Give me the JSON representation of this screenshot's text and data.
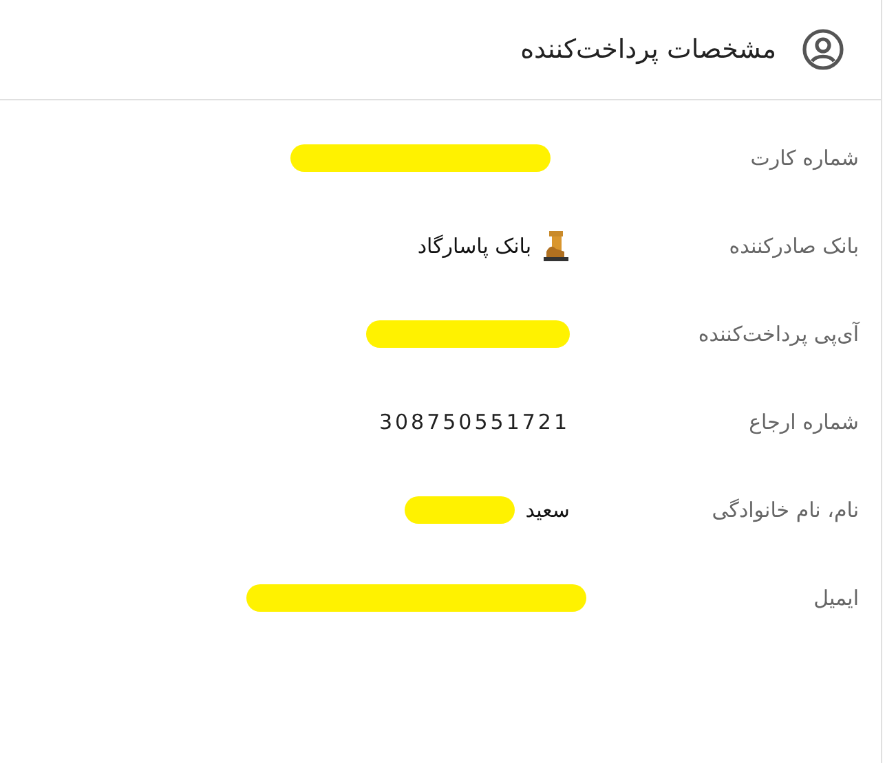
{
  "header": {
    "title": "مشخصات پرداخت‌کننده"
  },
  "rows": [
    {
      "label": "شماره کارت",
      "kind": "redacted"
    },
    {
      "label": "بانک صادرکننده",
      "kind": "bank",
      "value": "بانک پاسارگاد"
    },
    {
      "label": "آی‌پی پرداخت‌کننده",
      "kind": "redacted"
    },
    {
      "label": "شماره ارجاع",
      "kind": "number",
      "value": "308750551721"
    },
    {
      "label": "نام، نام خانوادگی",
      "kind": "name",
      "value": "سعید"
    },
    {
      "label": "ایمیل",
      "kind": "redacted"
    }
  ]
}
